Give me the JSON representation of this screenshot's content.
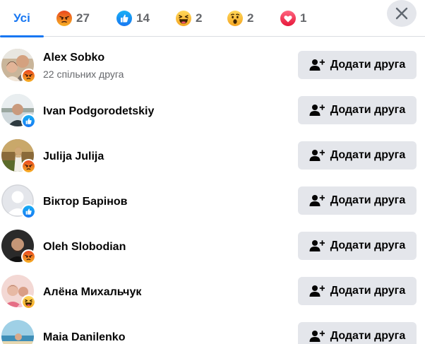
{
  "tabs": {
    "all_label": "Усі",
    "reactions": [
      {
        "icon": "angry-reaction-icon",
        "count": "27"
      },
      {
        "icon": "like-reaction-icon",
        "count": "14"
      },
      {
        "icon": "haha-reaction-icon",
        "count": "2"
      },
      {
        "icon": "wow-reaction-icon",
        "count": "2"
      },
      {
        "icon": "love-reaction-icon",
        "count": "1"
      }
    ]
  },
  "colors": {
    "accent": "#1877f2",
    "angry": "#f0523a",
    "haha": "#f7b125",
    "love": "#f33e58",
    "button_bg": "#e4e6eb",
    "secondary_text": "#65676b"
  },
  "people": [
    {
      "name": "Alex Sobko",
      "mutual": "22 спільних друга",
      "reaction": "angry-reaction-icon",
      "button": "Додати друга"
    },
    {
      "name": "Ivan Podgorodetskiy",
      "mutual": "",
      "reaction": "like-reaction-icon",
      "button": "Додати друга"
    },
    {
      "name": "Julija Julija",
      "mutual": "",
      "reaction": "angry-reaction-icon",
      "button": "Додати друга"
    },
    {
      "name": "Віктор Барінов",
      "mutual": "",
      "reaction": "like-reaction-icon",
      "button": "Додати друга"
    },
    {
      "name": "Oleh Slobodian",
      "mutual": "",
      "reaction": "angry-reaction-icon",
      "button": "Додати друга"
    },
    {
      "name": "Алёна Михальчук",
      "mutual": "",
      "reaction": "haha-reaction-icon",
      "button": "Додати друга"
    },
    {
      "name": "Maia Danilenko",
      "mutual": "",
      "reaction": "",
      "button": "Додати друга"
    }
  ]
}
